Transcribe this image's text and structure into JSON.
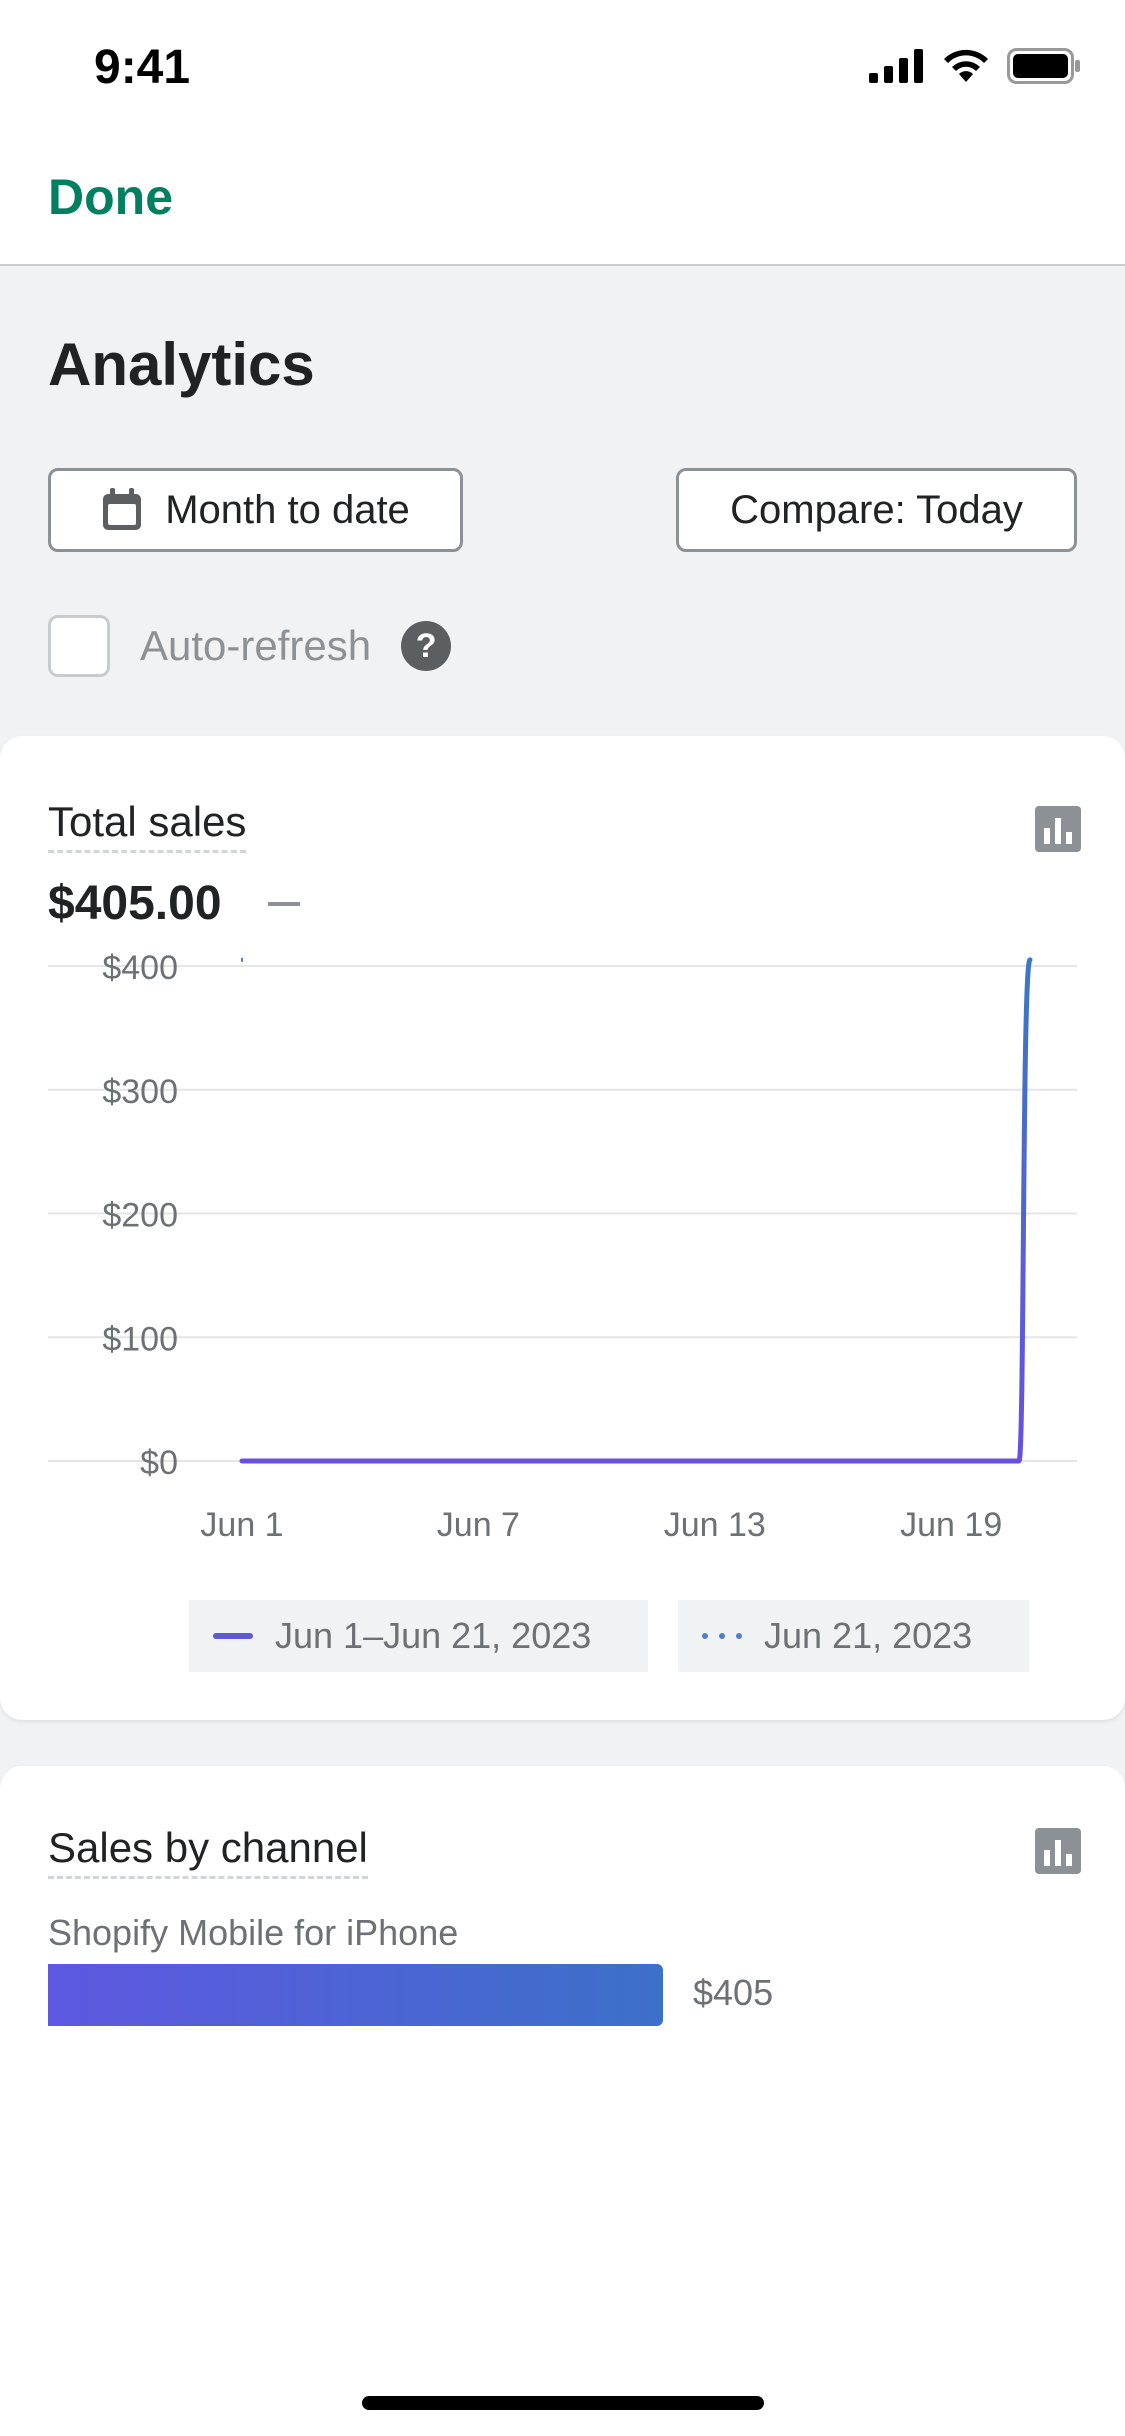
{
  "status_bar": {
    "time": "9:41",
    "icons": [
      "signal-icon",
      "wifi-icon",
      "battery-icon"
    ]
  },
  "nav": {
    "done_label": "Done",
    "accent_color": "#008060"
  },
  "page": {
    "title": "Analytics"
  },
  "filters": {
    "date_range_label": "Month to date",
    "date_range_icon": "calendar-icon",
    "compare_label": "Compare: Today",
    "auto_refresh_label": "Auto-refresh",
    "auto_refresh_checked": false,
    "help_glyph": "?"
  },
  "total_sales_card": {
    "title": "Total sales",
    "value": "$405.00",
    "icon": "bar-chart-icon",
    "legend": {
      "current": "Jun 1–Jun 21, 2023",
      "compare": "Jun 21, 2023"
    }
  },
  "chart_data": {
    "type": "line",
    "title": "Total sales",
    "x": [
      "Jun 1",
      "Jun 2",
      "Jun 3",
      "Jun 4",
      "Jun 5",
      "Jun 6",
      "Jun 7",
      "Jun 8",
      "Jun 9",
      "Jun 10",
      "Jun 11",
      "Jun 12",
      "Jun 13",
      "Jun 14",
      "Jun 15",
      "Jun 16",
      "Jun 17",
      "Jun 18",
      "Jun 19",
      "Jun 20",
      "Jun 21"
    ],
    "x_tick_labels": [
      "Jun 1",
      "Jun 7",
      "Jun 13",
      "Jun 19"
    ],
    "y_tick_labels": [
      "$0",
      "$100",
      "$200",
      "$300",
      "$400"
    ],
    "ylim": [
      0,
      400
    ],
    "grid": true,
    "legend_placement": "bottom",
    "series": [
      {
        "name": "Jun 1–Jun 21, 2023",
        "style": "solid",
        "color_start": "#6a4fe0",
        "color_end": "#3b78c4",
        "values": [
          0,
          0,
          0,
          0,
          0,
          0,
          0,
          0,
          0,
          0,
          0,
          0,
          0,
          0,
          0,
          0,
          0,
          0,
          0,
          0,
          405
        ]
      },
      {
        "name": "Jun 21, 2023",
        "style": "dotted",
        "color": "#4f7fc9",
        "values": [
          405
        ]
      }
    ]
  },
  "sales_by_channel_card": {
    "title": "Sales by channel",
    "icon": "bar-chart-icon",
    "channels": [
      {
        "name": "Shopify Mobile for iPhone",
        "value": 405,
        "value_label": "$405"
      }
    ]
  }
}
